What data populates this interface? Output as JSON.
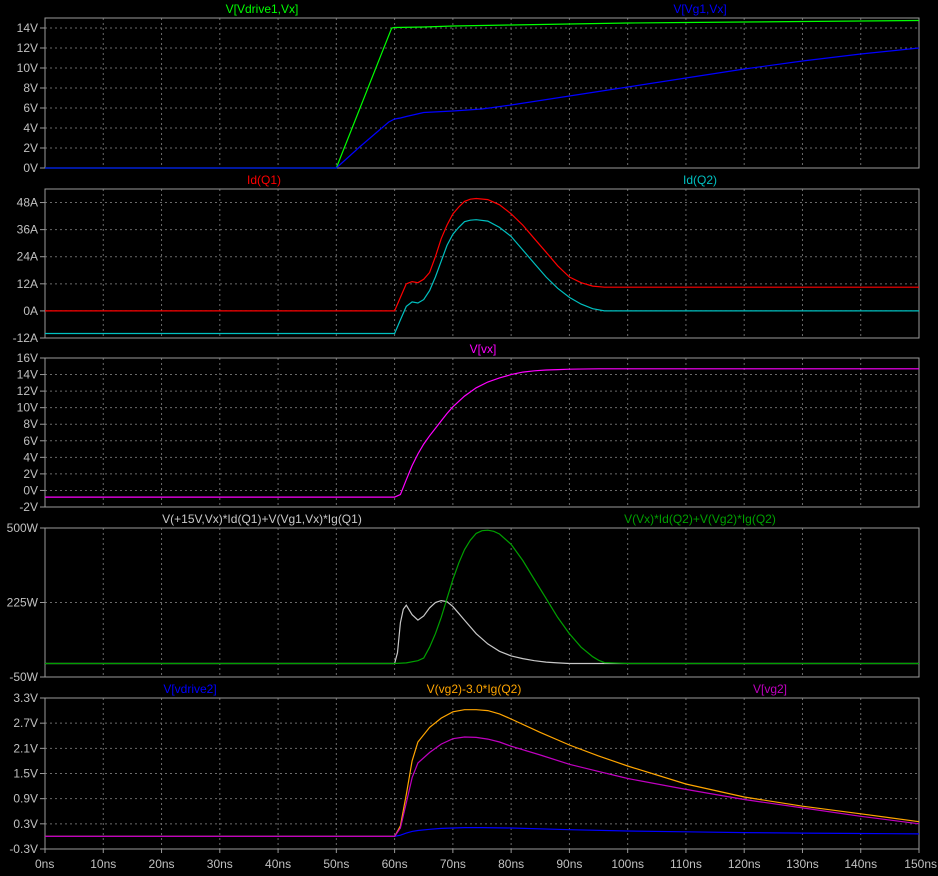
{
  "chart_data": [
    {
      "type": "line",
      "title": "",
      "xlabel": "",
      "ylabel": "",
      "xlim": [
        0,
        150
      ],
      "ylim": [
        0,
        15
      ],
      "yticks": [
        "0V",
        "2V",
        "4V",
        "6V",
        "8V",
        "10V",
        "12V",
        "14V"
      ],
      "yticks_values": [
        0,
        2,
        4,
        6,
        8,
        10,
        12,
        14
      ],
      "grid": true,
      "series": [
        {
          "name": "V[Vdrive1,Vx]",
          "color": "#00ff00",
          "x": [
            0,
            50,
            59.5,
            60,
            65,
            70,
            80,
            90,
            100,
            110,
            120,
            130,
            140,
            150
          ],
          "y": [
            0,
            0,
            14,
            14.05,
            14.1,
            14.2,
            14.3,
            14.4,
            14.5,
            14.55,
            14.6,
            14.65,
            14.7,
            14.75
          ]
        },
        {
          "name": "V[Vg1,Vx]",
          "color": "#0000ff",
          "x": [
            0,
            50,
            54,
            57,
            59,
            60,
            61,
            62,
            65,
            70,
            75,
            80,
            90,
            100,
            110,
            120,
            130,
            140,
            150
          ],
          "y": [
            0,
            0,
            2.1,
            3.6,
            4.6,
            4.9,
            5,
            5.15,
            5.55,
            5.7,
            5.9,
            6.3,
            7.2,
            8.1,
            9,
            9.9,
            10.7,
            11.4,
            12
          ]
        }
      ]
    },
    {
      "type": "line",
      "title": "",
      "xlabel": "",
      "ylabel": "",
      "xlim": [
        0,
        150
      ],
      "ylim": [
        -12,
        54
      ],
      "yticks": [
        "-12A",
        "0A",
        "12A",
        "24A",
        "36A",
        "48A"
      ],
      "yticks_values": [
        -12,
        0,
        12,
        24,
        36,
        48
      ],
      "grid": true,
      "series": [
        {
          "name": "Id(Q1)",
          "color": "#ff0000",
          "x": [
            0,
            60,
            61,
            62,
            63,
            64,
            65,
            66,
            67,
            68,
            69,
            70,
            71,
            72,
            73,
            74,
            76,
            78,
            80,
            82,
            84,
            86,
            88,
            90,
            92,
            94,
            96,
            98,
            100,
            110,
            120,
            130,
            140,
            150
          ],
          "y": [
            0,
            0,
            6,
            12,
            13,
            12.5,
            14,
            17,
            24,
            32,
            38,
            43,
            46,
            48.5,
            49.5,
            49.8,
            49.3,
            47,
            43,
            38,
            32,
            26,
            20,
            15,
            12.5,
            11,
            10.5,
            10.5,
            10.5,
            10.5,
            10.5,
            10.5,
            10.5,
            10.5
          ]
        },
        {
          "name": "Id(Q2)",
          "color": "#00c0c0",
          "x": [
            0,
            60,
            61,
            62,
            63,
            64,
            65,
            66,
            67,
            68,
            69,
            70,
            71,
            72,
            73,
            74,
            76,
            78,
            80,
            82,
            84,
            86,
            88,
            90,
            92,
            94,
            96,
            98,
            100,
            150
          ],
          "y": [
            -10,
            -10,
            -4,
            2,
            4,
            3.5,
            5,
            9,
            15,
            22,
            29,
            34,
            37,
            39.5,
            40.2,
            40.4,
            39.8,
            37,
            33,
            27,
            21,
            15,
            10,
            6,
            3,
            1,
            0,
            0,
            0,
            0
          ]
        }
      ]
    },
    {
      "type": "line",
      "title": "",
      "xlabel": "",
      "ylabel": "",
      "xlim": [
        0,
        150
      ],
      "ylim": [
        -2,
        16
      ],
      "yticks": [
        "-2V",
        "0V",
        "2V",
        "4V",
        "6V",
        "8V",
        "10V",
        "12V",
        "14V",
        "16V"
      ],
      "yticks_values": [
        -2,
        0,
        2,
        4,
        6,
        8,
        10,
        12,
        14,
        16
      ],
      "grid": true,
      "series": [
        {
          "name": "V[vx]",
          "color": "#ff00ff",
          "x": [
            0,
            60,
            61,
            62,
            63,
            64,
            65,
            66,
            67,
            68,
            69,
            70,
            72,
            74,
            76,
            78,
            80,
            82,
            84,
            86,
            88,
            90,
            95,
            100,
            150
          ],
          "y": [
            -0.8,
            -0.8,
            -0.5,
            1.3,
            3,
            4.4,
            5.6,
            6.6,
            7.5,
            8.4,
            9.3,
            10.1,
            11.4,
            12.4,
            13.1,
            13.6,
            14,
            14.3,
            14.45,
            14.55,
            14.6,
            14.65,
            14.7,
            14.7,
            14.7
          ]
        }
      ]
    },
    {
      "type": "line",
      "title": "",
      "xlabel": "",
      "ylabel": "",
      "xlim": [
        0,
        150
      ],
      "ylim": [
        -50,
        500
      ],
      "yticks": [
        "-50W",
        "225W",
        "500W"
      ],
      "yticks_values": [
        -50,
        225,
        500
      ],
      "grid": true,
      "series": [
        {
          "name": "V(+15V,Vx)*Id(Q1)+V(Vg1,Vx)*Ig(Q1)",
          "color": "#c8c8c8",
          "x": [
            0,
            60,
            60.5,
            61,
            61.5,
            62,
            63,
            64,
            65,
            66,
            67,
            68,
            69,
            70,
            71,
            72,
            74,
            76,
            78,
            80,
            82,
            84,
            86,
            88,
            90,
            95,
            100,
            150
          ],
          "y": [
            0,
            0,
            40,
            150,
            200,
            215,
            180,
            160,
            175,
            205,
            225,
            232,
            228,
            210,
            185,
            160,
            110,
            72,
            45,
            28,
            18,
            10,
            5,
            2,
            0,
            0,
            0,
            0
          ]
        },
        {
          "name": "V(Vx)*Id(Q2)+V(Vg2)*Ig(Q2)",
          "color": "#00a000",
          "x": [
            0,
            60,
            62,
            64,
            65,
            66,
            67,
            68,
            69,
            70,
            71,
            72,
            73,
            74,
            75,
            76,
            77,
            78,
            80,
            82,
            84,
            86,
            88,
            90,
            92,
            94,
            95,
            96,
            100,
            150
          ],
          "y": [
            0,
            0,
            2,
            10,
            20,
            60,
            110,
            170,
            240,
            310,
            370,
            420,
            455,
            480,
            490,
            492,
            488,
            478,
            440,
            380,
            310,
            240,
            170,
            110,
            60,
            25,
            12,
            3,
            0,
            0
          ]
        }
      ]
    },
    {
      "type": "line",
      "title": "",
      "xlabel": "",
      "ylabel": "",
      "xlim": [
        0,
        150
      ],
      "ylim": [
        -0.3,
        3.3
      ],
      "xticks": [
        "0ns",
        "10ns",
        "20ns",
        "30ns",
        "40ns",
        "50ns",
        "60ns",
        "70ns",
        "80ns",
        "90ns",
        "100ns",
        "110ns",
        "120ns",
        "130ns",
        "140ns",
        "150ns"
      ],
      "xticks_values": [
        0,
        10,
        20,
        30,
        40,
        50,
        60,
        70,
        80,
        90,
        100,
        110,
        120,
        130,
        140,
        150
      ],
      "yticks": [
        "-0.3V",
        "0.3V",
        "0.9V",
        "1.5V",
        "2.1V",
        "2.7V",
        "3.3V"
      ],
      "yticks_values": [
        -0.3,
        0.3,
        0.9,
        1.5,
        2.1,
        2.7,
        3.3
      ],
      "grid": true,
      "series": [
        {
          "name": "V[vdrive2]",
          "color": "#0000ff",
          "x": [
            0,
            60,
            61,
            62,
            63,
            64,
            66,
            68,
            70,
            72,
            75,
            80,
            90,
            100,
            110,
            120,
            130,
            140,
            150
          ],
          "y": [
            0,
            0,
            0.03,
            0.08,
            0.12,
            0.14,
            0.17,
            0.19,
            0.2,
            0.21,
            0.21,
            0.2,
            0.16,
            0.13,
            0.11,
            0.09,
            0.08,
            0.07,
            0.06
          ]
        },
        {
          "name": "V(vg2)-3.0*Ig(Q2)",
          "color": "#ffa500",
          "x": [
            0,
            60,
            61,
            62,
            63,
            64,
            66,
            68,
            70,
            72,
            74,
            76,
            78,
            80,
            85,
            90,
            95,
            100,
            110,
            120,
            130,
            140,
            150
          ],
          "y": [
            0,
            0,
            0.25,
            1,
            1.8,
            2.25,
            2.6,
            2.82,
            2.97,
            3.02,
            3.02,
            3,
            2.92,
            2.8,
            2.48,
            2.18,
            1.92,
            1.68,
            1.25,
            0.94,
            0.72,
            0.54,
            0.35
          ]
        },
        {
          "name": "V[vg2]",
          "color": "#c000c0",
          "x": [
            0,
            60,
            61,
            62,
            63,
            64,
            66,
            68,
            70,
            72,
            74,
            76,
            78,
            80,
            85,
            90,
            95,
            100,
            110,
            120,
            130,
            140,
            150
          ],
          "y": [
            0,
            0,
            0.2,
            0.8,
            1.4,
            1.75,
            2,
            2.2,
            2.33,
            2.37,
            2.36,
            2.32,
            2.25,
            2.15,
            1.94,
            1.72,
            1.55,
            1.38,
            1.12,
            0.88,
            0.68,
            0.48,
            0.3
          ]
        }
      ]
    }
  ]
}
